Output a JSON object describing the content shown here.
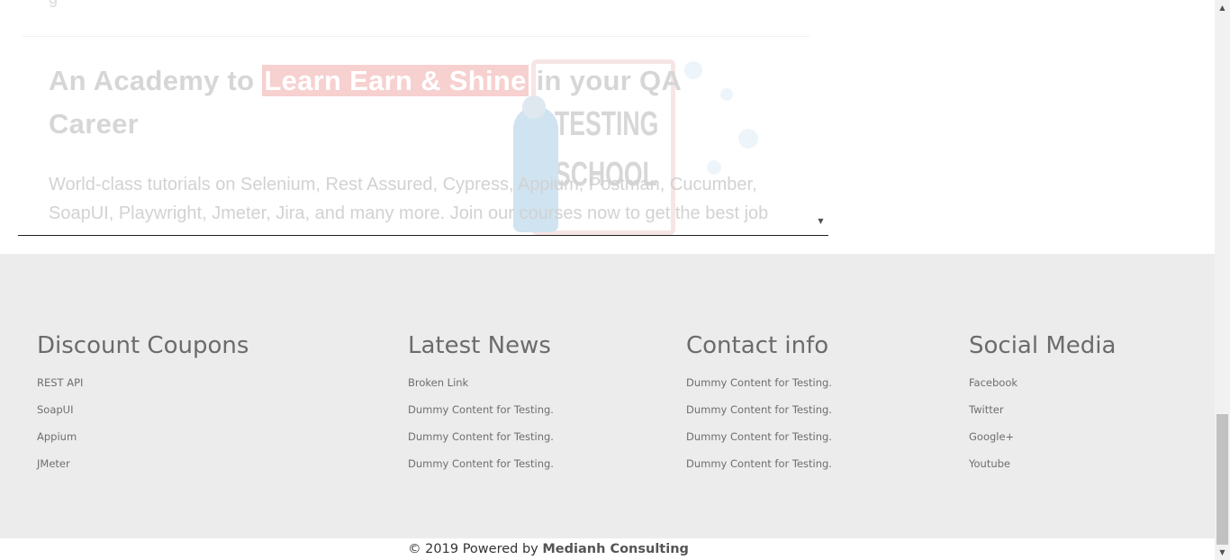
{
  "iframe": {
    "hero": {
      "heading_before": "An Academy to ",
      "heading_highlight": "Learn Earn & Shine",
      "heading_after": "  in your QA Career",
      "description": "World-class tutorials on Selenium, Rest Assured, Cypress, Appium, Postman, Cucumber, SoapUI, Playwright, Jmeter, Jira, and many more. Join our courses now to get the best job"
    },
    "illustration": {
      "line1": "TESTING",
      "line2": "SCHOOL"
    }
  },
  "footer": {
    "columns": [
      {
        "title": "Discount Coupons",
        "links": [
          "REST API",
          "SoapUI",
          "Appium",
          "JMeter"
        ]
      },
      {
        "title": "Latest News",
        "links": [
          "Broken Link",
          "Dummy Content for Testing.",
          "Dummy Content for Testing.",
          "Dummy Content for Testing."
        ]
      },
      {
        "title": "Contact info",
        "links": [
          "Dummy Content for Testing.",
          "Dummy Content for Testing.",
          "Dummy Content for Testing.",
          "Dummy Content for Testing."
        ]
      },
      {
        "title": "Social Media",
        "links": [
          "Facebook",
          "Twitter",
          "Google+",
          "Youtube"
        ]
      }
    ],
    "copyright": {
      "text": "© 2019 Powered by ",
      "brand": "Medianh Consulting"
    }
  },
  "colors": {
    "footer_bg": "#ececec",
    "highlight_bg": "#f7d0d0",
    "heading_text": "#d6d6d6"
  },
  "icons": {
    "scroll_up": "triangle-up-icon",
    "scroll_down": "triangle-down-icon"
  }
}
